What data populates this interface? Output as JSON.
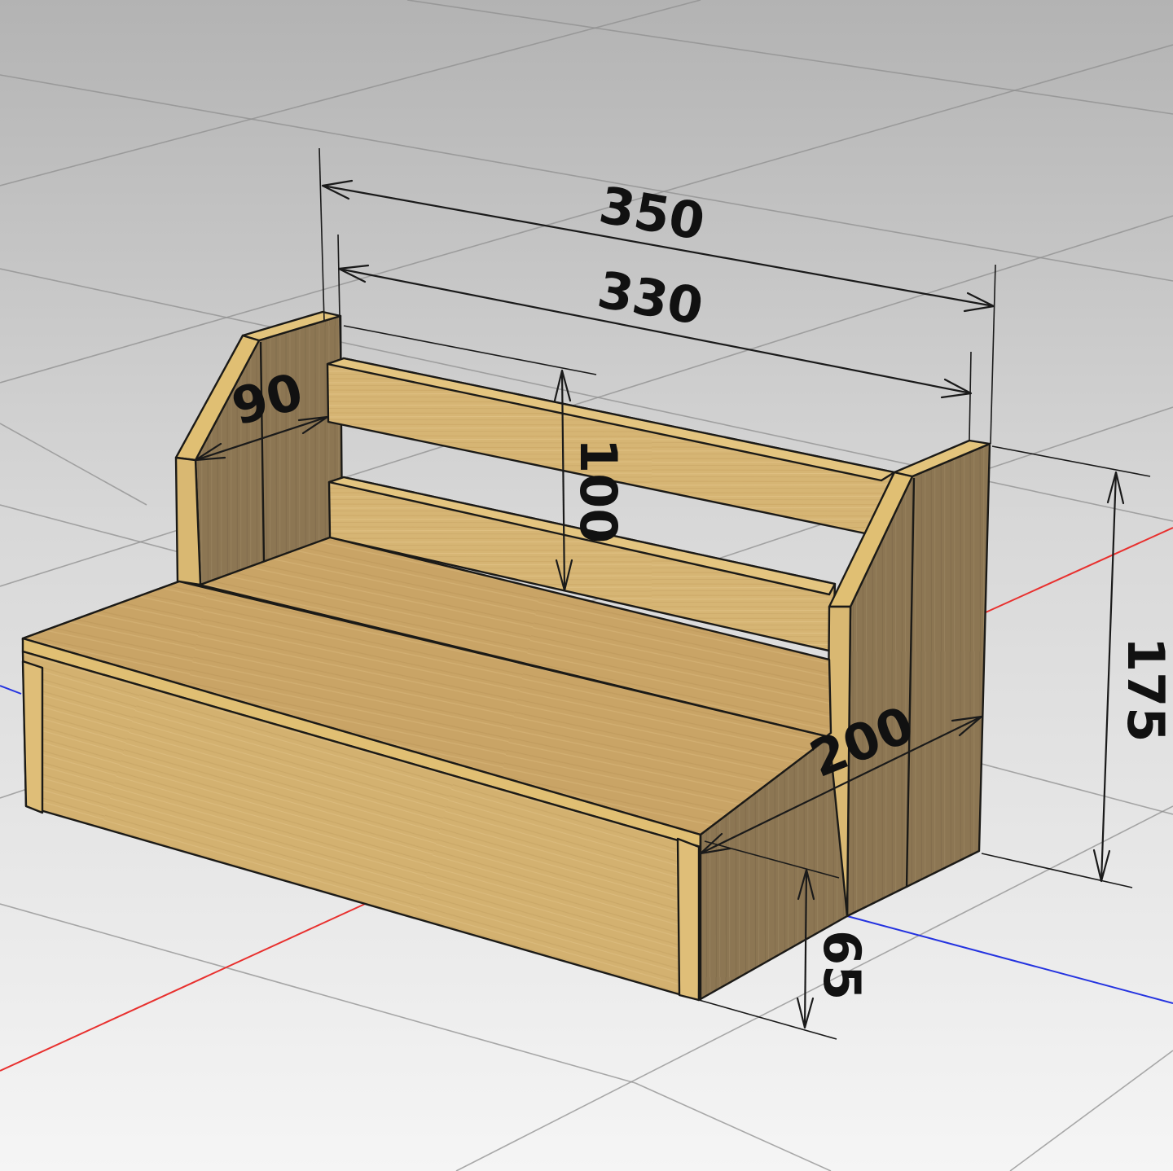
{
  "scene": {
    "object": "bench",
    "view": "3d-perspective",
    "colors": {
      "background_top": "#b5b5b5",
      "background_bottom": "#f4f4f4",
      "grid": "#8f8f8f",
      "axis_x": "#e8302e",
      "axis_y": "#2433e0",
      "wood_light": "#d9b877",
      "wood_mid": "#c9a465",
      "wood_dark": "#8d7755",
      "wood_edge": "#e0bf73",
      "outline": "#1b1a17",
      "dimension": "#111111"
    }
  },
  "dimensions": {
    "overall_width": "350",
    "inner_width": "330",
    "back_height": "100",
    "total_height": "175",
    "depth": "200",
    "side_top_depth": "90",
    "seat_height": "65"
  }
}
